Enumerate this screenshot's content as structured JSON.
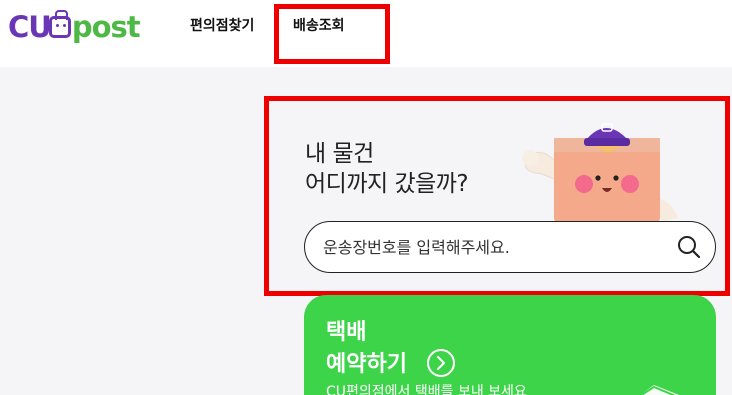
{
  "header": {
    "logo": {
      "cu": "CU",
      "post": "post"
    },
    "nav": [
      {
        "label": "편의점찾기"
      },
      {
        "label": "배송조회"
      }
    ]
  },
  "tracking": {
    "headline_line1": "내 물건",
    "headline_line2": "어디까지 갔을까?",
    "search_placeholder": "운송장번호를 입력해주세요."
  },
  "reserve_card": {
    "title_line1": "택배",
    "title_line2": "예약하기",
    "subtitle": "CU편의점에서 택배를 보내 보세요"
  },
  "colors": {
    "brand_purple": "#6a36b6",
    "brand_green": "#4db845",
    "card_green": "#3dd44a",
    "highlight_red": "#ee0000"
  },
  "icons": [
    "search-icon",
    "arrow-right-icon",
    "mascot-image",
    "parcel-box-icon"
  ]
}
